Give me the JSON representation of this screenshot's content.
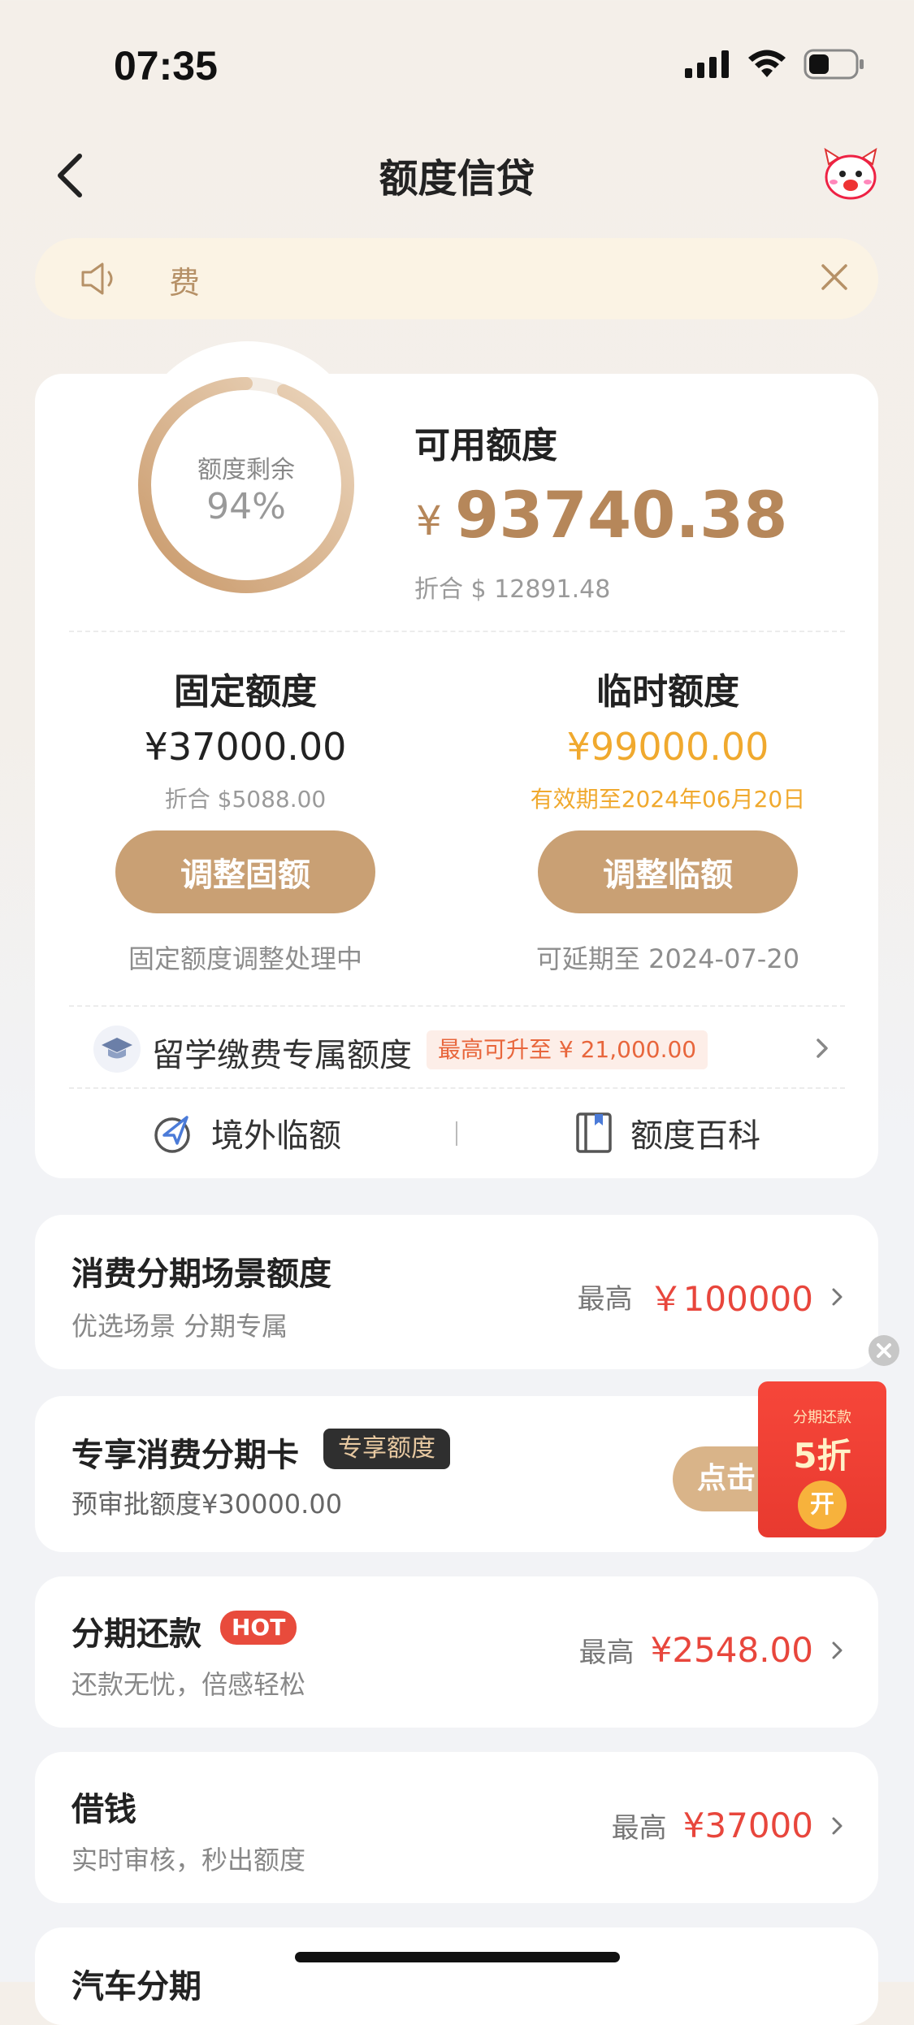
{
  "status_bar": {
    "time": "07:35"
  },
  "nav": {
    "title": "额度信贷"
  },
  "notice": {
    "text": "费"
  },
  "credit": {
    "ring_label": "额度剩余",
    "ring_percent": "94%",
    "ring_fraction": 0.94,
    "available_label": "可用额度",
    "currency": "¥",
    "available_amount": "93740.38",
    "available_conversion": "折合 $ 12891.48",
    "fixed": {
      "title": "固定额度",
      "amount": "¥37000.00",
      "conversion": "折合 $5088.00",
      "button": "调整固额",
      "note": "固定额度调整处理中"
    },
    "temporary": {
      "title": "临时额度",
      "amount": "¥99000.00",
      "validity": "有效期至2024年06月20日",
      "button": "调整临额",
      "note": "可延期至 2024-07-20"
    },
    "study": {
      "label": "留学缴费专属额度",
      "badge": "最高可升至 ¥ 21,000.00"
    },
    "links": {
      "overseas": "境外临额",
      "wiki": "额度百科"
    }
  },
  "items": {
    "consume": {
      "title": "消费分期场景额度",
      "sub": "优选场景 分期专属",
      "max_label": "最高",
      "value": "￥100000"
    },
    "card": {
      "title": "专享消费分期卡",
      "tag": "专享额度",
      "sub": "预审批额度¥30000.00",
      "button": "点击"
    },
    "installment": {
      "title": "分期还款",
      "tag": "HOT",
      "sub": "还款无忧，倍感轻松",
      "max_label": "最高",
      "value": "¥2548.00"
    },
    "borrow": {
      "title": "借钱",
      "sub": "实时审核，秒出额度",
      "max_label": "最高",
      "value": "¥37000"
    },
    "car": {
      "title": "汽车分期"
    }
  },
  "promo": {
    "top": "分期还款",
    "discount": "5折",
    "open": "开"
  },
  "colors": {
    "accent": "#c9a074",
    "gold_text": "#b6875a",
    "orange": "#f0a92e",
    "red": "#e8463c"
  }
}
